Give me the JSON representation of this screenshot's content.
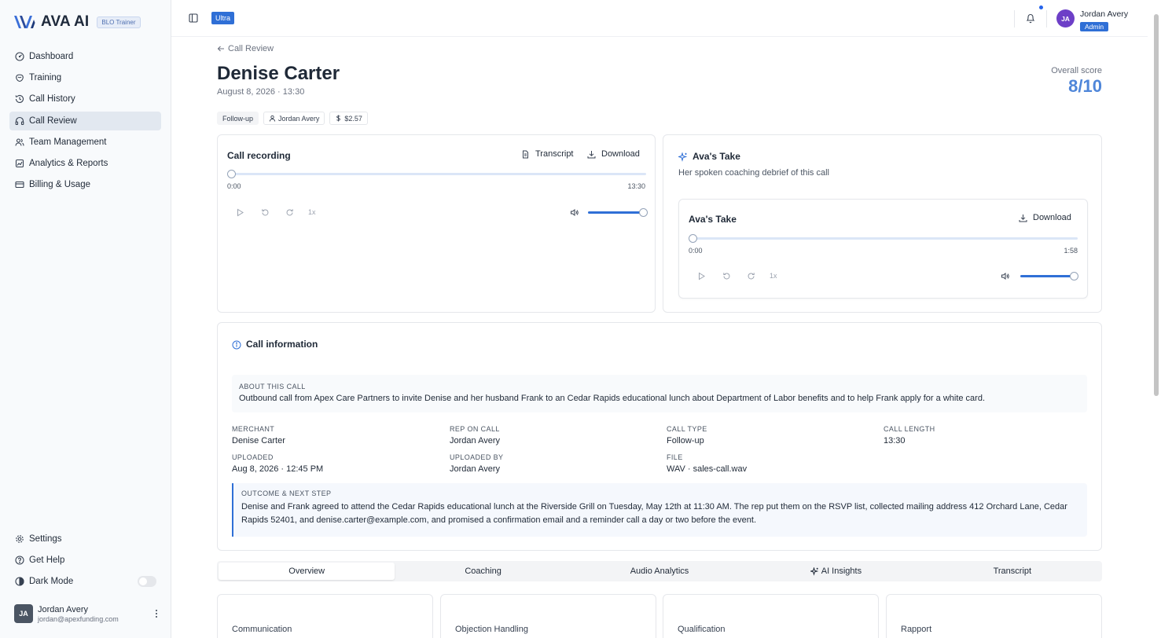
{
  "brand": {
    "name": "AVA AI",
    "badge": "BLO Trainer"
  },
  "sidebar": {
    "items": [
      {
        "label": "Dashboard",
        "icon": "dashboard-icon"
      },
      {
        "label": "Training",
        "icon": "training-icon"
      },
      {
        "label": "Call History",
        "icon": "history-icon"
      },
      {
        "label": "Call Review",
        "icon": "headphones-icon",
        "active": true
      },
      {
        "label": "Team Management",
        "icon": "users-icon"
      },
      {
        "label": "Analytics & Reports",
        "icon": "analytics-icon"
      },
      {
        "label": "Billing & Usage",
        "icon": "credit-card-icon"
      }
    ],
    "bottom": {
      "settings": "Settings",
      "help": "Get Help",
      "dark_mode": "Dark Mode",
      "dark_mode_on": false
    },
    "user": {
      "initials": "JA",
      "name": "Jordan Avery",
      "email": "jordan@apexfunding.com"
    }
  },
  "header": {
    "plan": "Ultra",
    "user": {
      "initials": "JA",
      "name": "Jordan Avery",
      "role": "Admin"
    }
  },
  "page": {
    "back_label": "Call Review",
    "title": "Denise Carter",
    "subtitle": "August 8, 2026 · 13:30",
    "score_label": "Overall score",
    "score_value": "8/10",
    "chips": {
      "type": "Follow-up",
      "rep": "Jordan Avery",
      "cost": "$2.57"
    }
  },
  "recording": {
    "title": "Call recording",
    "transcript_label": "Transcript",
    "download_label": "Download",
    "time_start": "0:00",
    "time_end": "13:30",
    "speed": "1x",
    "progress": 0,
    "volume": 1
  },
  "ava": {
    "title": "Ava's Take",
    "subtitle": "Her spoken coaching debrief of this call",
    "player_title": "Ava's Take",
    "download_label": "Download",
    "time_start": "0:00",
    "time_end": "1:58",
    "speed": "1x",
    "progress": 0,
    "volume": 1
  },
  "call_info": {
    "title": "Call information",
    "about_caption": "ABOUT THIS CALL",
    "about_text": "Outbound call from Apex Care Partners to invite Denise and her husband Frank to an Cedar Rapids educational lunch about Department of Labor benefits and to help Frank apply for a white card.",
    "fields": [
      {
        "caption": "MERCHANT",
        "value": "Denise Carter"
      },
      {
        "caption": "REP ON CALL",
        "value": "Jordan Avery"
      },
      {
        "caption": "CALL TYPE",
        "value": "Follow-up"
      },
      {
        "caption": "CALL LENGTH",
        "value": "13:30"
      },
      {
        "caption": "UPLOADED",
        "value": "Aug 8, 2026 · 12:45 PM"
      },
      {
        "caption": "UPLOADED BY",
        "value": "Jordan Avery"
      },
      {
        "caption": "FILE",
        "value": "WAV · sales-call.wav"
      }
    ],
    "outcome_caption": "OUTCOME & NEXT STEP",
    "outcome_text": "Denise and Frank agreed to attend the Cedar Rapids educational lunch at the Riverside Grill on Tuesday, May 12th at 11:30 AM. The rep put them on the RSVP list, collected mailing address 412 Orchard Lane, Cedar Rapids 52401, and denise.carter@example.com, and promised a confirmation email and a reminder call a day or two before the event."
  },
  "tabs": [
    {
      "label": "Overview",
      "active": true
    },
    {
      "label": "Coaching"
    },
    {
      "label": "Audio Analytics"
    },
    {
      "label": "AI Insights"
    },
    {
      "label": "Transcript"
    }
  ],
  "metrics": [
    "Communication",
    "Objection Handling",
    "Qualification",
    "Rapport"
  ],
  "colors": {
    "accent": "#2f6fd6",
    "score": "#4f86d9",
    "avatar": "#6d3fc7"
  }
}
